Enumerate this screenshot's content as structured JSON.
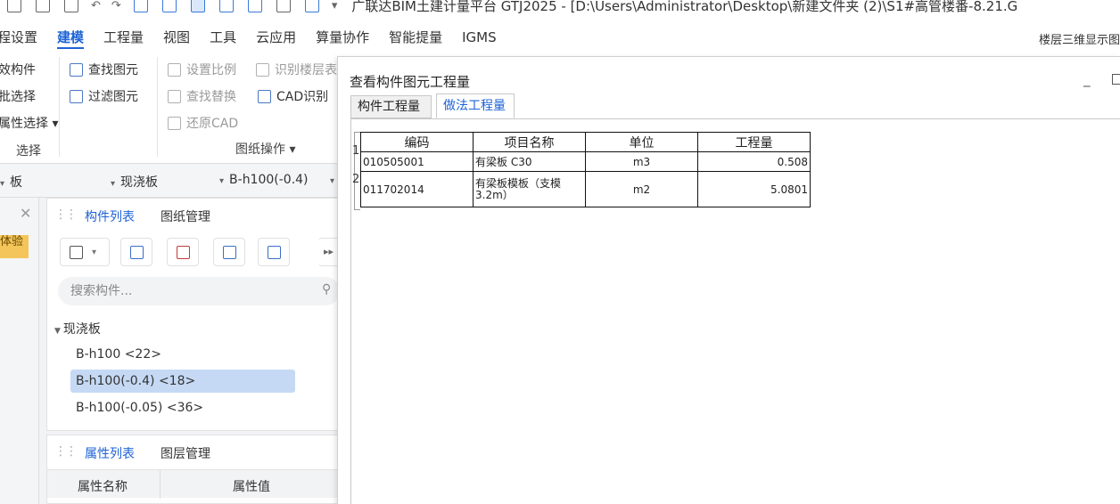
{
  "titlebar": {
    "title": "广联达BIM土建计量平台 GTJ2025 - [D:\\Users\\Administrator\\Desktop\\新建文件夹 (2)\\S1#高管楼番-8.21.G"
  },
  "menu": {
    "items": [
      "程设置",
      "建模",
      "工程量",
      "视图",
      "工具",
      "云应用",
      "算量协作",
      "智能提量",
      "IGMS"
    ],
    "active_index": 1,
    "right_label": "楼层三维显示图"
  },
  "ribbon": {
    "select_group": {
      "items": [
        "效构件",
        "批选择",
        "属性选择 ▾"
      ],
      "label": "选择"
    },
    "find_items": [
      "查找图元",
      "过滤图元"
    ],
    "drawing_items": {
      "set_scale": "设置比例",
      "identify_floor": "识别楼层表",
      "find_replace": "查找替换",
      "cad_identify": "CAD识别",
      "restore_cad": "还原CAD"
    },
    "drawing_group_label": "图纸操作 ▾"
  },
  "selector_bar": {
    "floor_type": "板",
    "category": "现浇板",
    "component": "B-h100(-0.4)"
  },
  "left_strip": {
    "badge": "体验"
  },
  "component_panel": {
    "tabs": [
      "构件列表",
      "图纸管理"
    ],
    "search_placeholder": "搜索构件...",
    "group": "现浇板",
    "items": [
      "B-h100 <22>",
      "B-h100(-0.4) <18>",
      "B-h100(-0.05) <36>"
    ],
    "selected_index": 1
  },
  "property_panel": {
    "tabs": [
      "属性列表",
      "图层管理"
    ],
    "columns": [
      "属性名称",
      "属性值"
    ]
  },
  "dialog": {
    "title": "查看构件图元工程量",
    "minimize": "_",
    "tabs": [
      "构件工程量",
      "做法工程量"
    ],
    "active_tab": 1,
    "table": {
      "headers": [
        "编码",
        "项目名称",
        "单位",
        "工程量"
      ],
      "rows": [
        {
          "num": "1",
          "code": "010505001",
          "name": "有梁板 C30",
          "unit": "m3",
          "qty": "0.508"
        },
        {
          "num": "2",
          "code": "011702014",
          "name": "有梁板模板（支模3.2m）",
          "unit": "m2",
          "qty": "5.0801"
        }
      ]
    }
  },
  "colors": {
    "accent": "#1e63d6",
    "selected_row": "#c5d9f4",
    "badge": "#f3c55a"
  }
}
